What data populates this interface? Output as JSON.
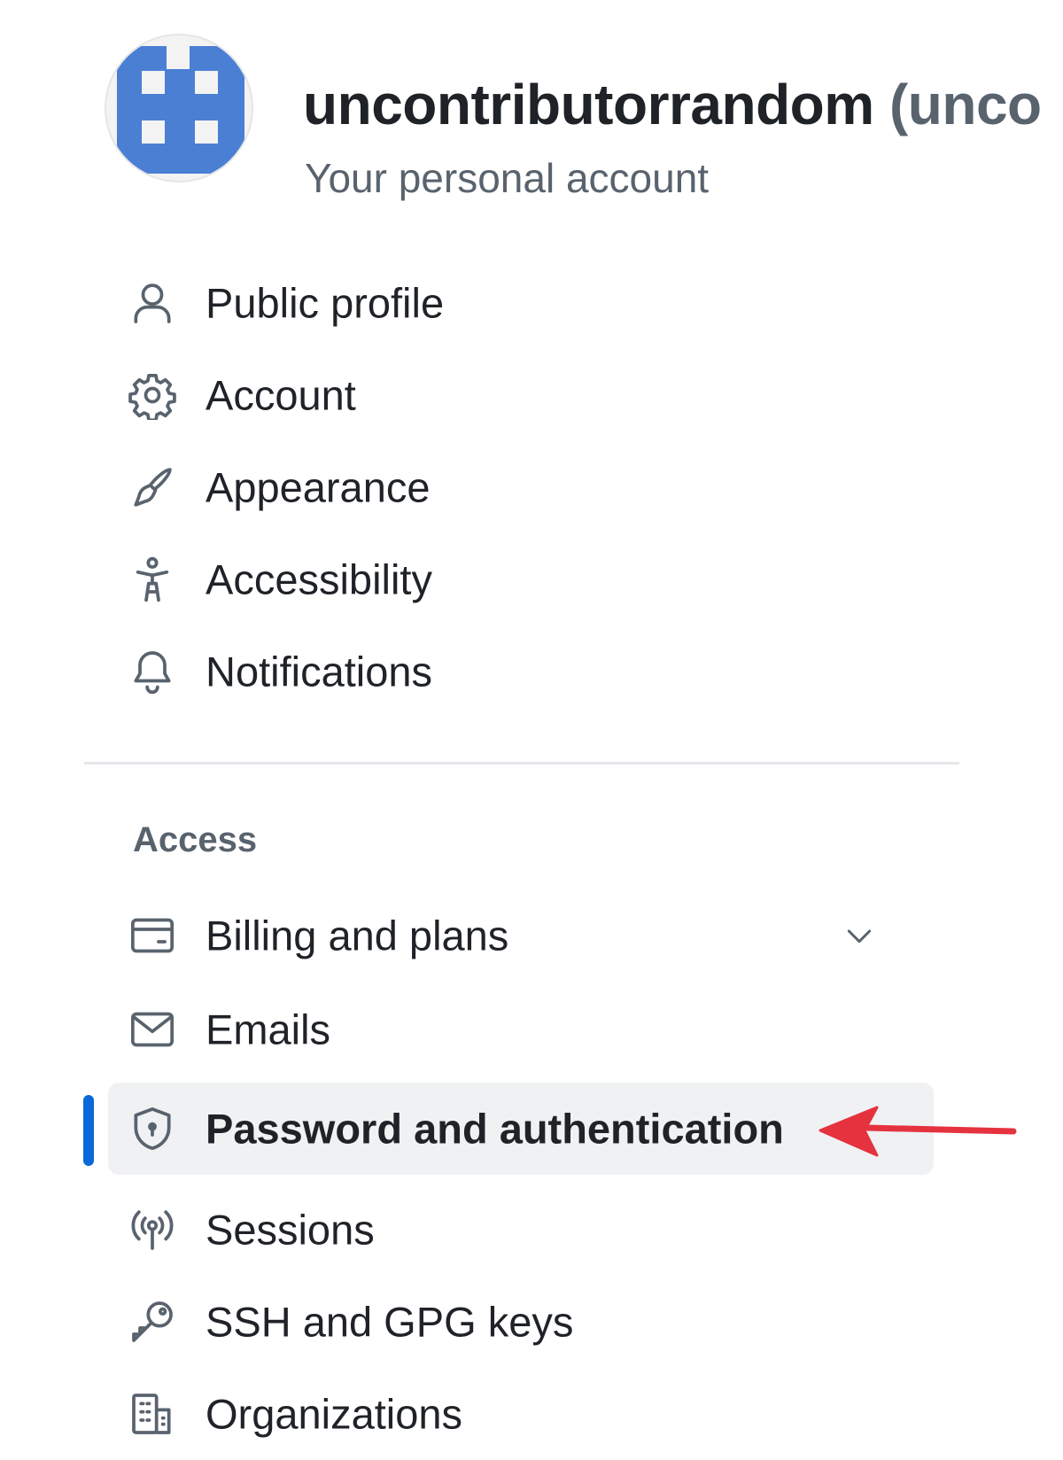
{
  "header": {
    "username": "uncontributorrandom",
    "login_fragment": "(unco",
    "subtitle": "Your personal account"
  },
  "nav": {
    "items": [
      {
        "label": "Public profile",
        "icon": "person-icon"
      },
      {
        "label": "Account",
        "icon": "gear-icon"
      },
      {
        "label": "Appearance",
        "icon": "paintbrush-icon"
      },
      {
        "label": "Accessibility",
        "icon": "accessibility-icon"
      },
      {
        "label": "Notifications",
        "icon": "bell-icon"
      }
    ],
    "access_heading": "Access",
    "access_items": [
      {
        "label": "Billing and plans",
        "icon": "credit-card-icon",
        "expandable": true
      },
      {
        "label": "Emails",
        "icon": "mail-icon"
      },
      {
        "label": "Password and authentication",
        "icon": "shield-lock-icon",
        "selected": true
      },
      {
        "label": "Sessions",
        "icon": "broadcast-icon"
      },
      {
        "label": "SSH and GPG keys",
        "icon": "key-icon"
      },
      {
        "label": "Organizations",
        "icon": "organization-icon"
      }
    ]
  },
  "colors": {
    "accent": "#0969da",
    "avatar": "#4a7fd4",
    "annotation_arrow": "#e5323f",
    "text": "#1f2328",
    "muted": "#59636e",
    "active_bg": "#f0f1f3"
  },
  "annotation": {
    "type": "arrow",
    "points_to": "Password and authentication"
  }
}
